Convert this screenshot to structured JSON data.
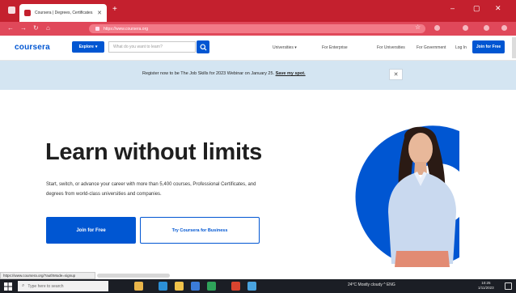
{
  "browser": {
    "tab_title": "Coursera | Degrees, Certificates...",
    "tab_close": "✕",
    "new_tab": "+",
    "url": "https://www.coursera.org",
    "window_controls": {
      "minimize": "–",
      "maximize": "▢",
      "close": "✕"
    },
    "nav_icons": [
      "back-icon",
      "forward-icon",
      "reload-icon",
      "home-icon"
    ]
  },
  "header": {
    "logo": "coursera",
    "explore_label": "Explore",
    "explore_chevron": "▾",
    "search_placeholder": "What do you want to learn?",
    "nav": {
      "universities": "Universities ▾",
      "for_enterprise": "For Enterprise",
      "for_universities": "For Universities",
      "for_government": "For Government",
      "log_in": "Log In"
    },
    "join_label": "Join for Free"
  },
  "banner": {
    "text": "Register now to be The Job Skills for 2023 Webinar on January 25.",
    "link": "Save my spot.",
    "close": "✕"
  },
  "hero": {
    "title": "Learn without limits",
    "description": "Start, switch, or advance your career with more than 5,400 courses, Professional Certificates, and degrees from world-class universities and companies.",
    "cta_primary": "Join for Free",
    "cta_secondary": "Try Coursera for Business"
  },
  "status": {
    "tooltip": "https://www.coursera.org/?authMode=signup"
  },
  "taskbar": {
    "search_placeholder": "Type here to search",
    "tray_text": "24°C Mostly cloudy  ^  ENG",
    "time": "10:25",
    "date": "1/11/2023"
  },
  "colors": {
    "brand": "#0056d2",
    "browser_accent": "#c4202e",
    "banner_bg": "#d4e5f2"
  }
}
